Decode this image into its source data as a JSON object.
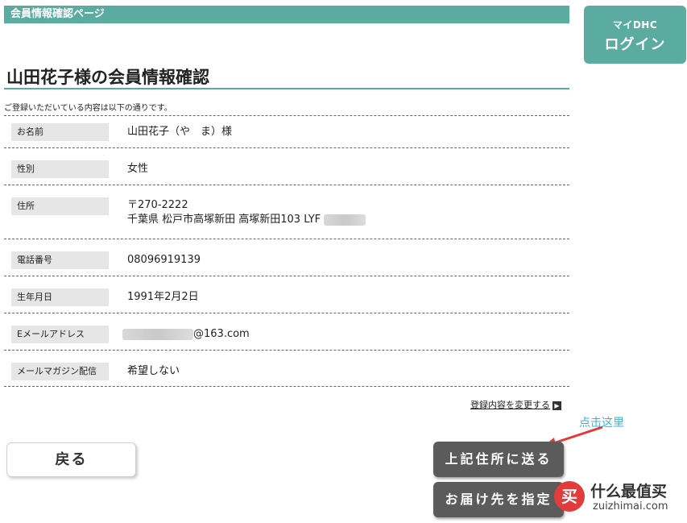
{
  "header": {
    "title": "会員情報確認ページ"
  },
  "login": {
    "small_label": "マイDHC",
    "big_label": "ログイン"
  },
  "page": {
    "title": "山田花子様の会員情報確認",
    "intro": "ご登録いただいている内容は以下の通りです。"
  },
  "fields": {
    "name": {
      "label": "お名前",
      "value": "山田花子（や　ま）様"
    },
    "gender": {
      "label": "性別",
      "value": "女性"
    },
    "address": {
      "label": "住所",
      "postal": "〒270-2222",
      "line": "千葉県 松戸市高塚新田 高塚新田103 LYF"
    },
    "phone": {
      "label": "電話番号",
      "value": "08096919139"
    },
    "birthday": {
      "label": "生年月日",
      "value": "1991年2月2日"
    },
    "email": {
      "label": "Eメールアドレス",
      "value": "@163.com"
    },
    "magazine": {
      "label": "メールマガジン配信",
      "value": "希望しない"
    }
  },
  "actions": {
    "change_link": "登録内容を変更する",
    "back": "戻る",
    "send_to_address": "上記住所に送る",
    "specify_destination": "お届け先を指定"
  },
  "annotation": {
    "text": "点击这里",
    "color": "#37b6d6"
  },
  "watermark": {
    "logo": "买",
    "brand": "什么最值买",
    "domain": "zuizhimai.com"
  },
  "colors": {
    "accent": "#5aaba0",
    "dark_button": "#5b5b5b",
    "arrow": "#e53935"
  }
}
